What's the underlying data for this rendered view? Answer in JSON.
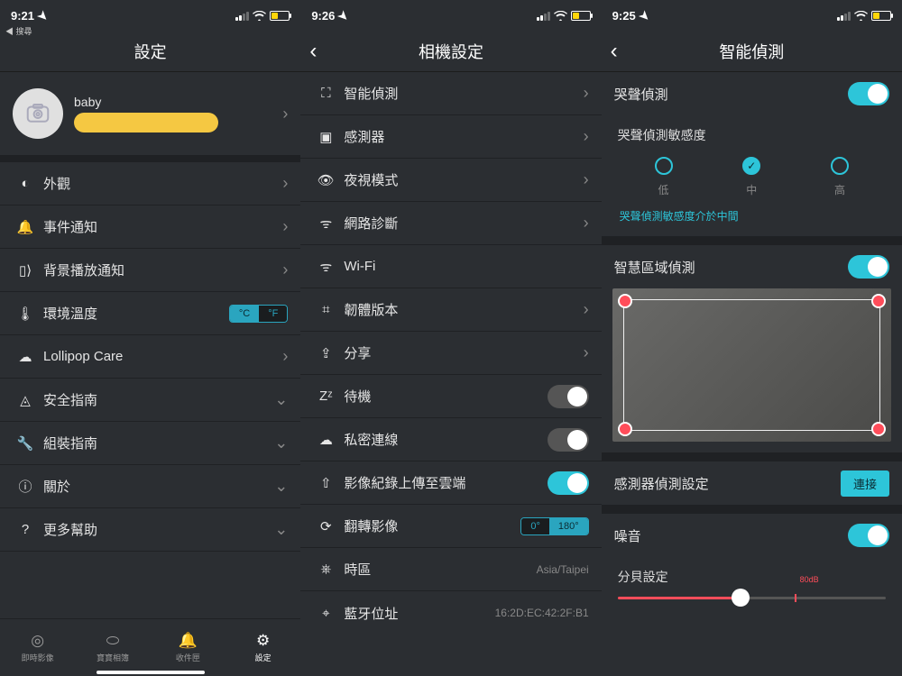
{
  "pane1": {
    "status": {
      "time": "9:21",
      "breadcrumb": "◀ 搜尋"
    },
    "title": "設定",
    "profile": {
      "name": "baby"
    },
    "items": [
      {
        "label": "外觀",
        "right": "chev"
      },
      {
        "label": "事件通知",
        "right": "chev"
      },
      {
        "label": "背景播放通知",
        "right": "chev"
      },
      {
        "label": "環境溫度",
        "right": "temp"
      },
      {
        "label": "Lollipop Care",
        "right": "chev"
      },
      {
        "label": "安全指南",
        "right": "down"
      },
      {
        "label": "組裝指南",
        "right": "down"
      },
      {
        "label": "關於",
        "right": "down"
      },
      {
        "label": "更多幫助",
        "right": "down"
      }
    ],
    "temp": {
      "on": "°C",
      "off": "°F"
    },
    "tabs": [
      {
        "label": "即時影像"
      },
      {
        "label": "寶寶相簿"
      },
      {
        "label": "收件匣"
      },
      {
        "label": "設定"
      }
    ]
  },
  "pane2": {
    "status": {
      "time": "9:26"
    },
    "title": "相機設定",
    "items": [
      {
        "label": "智能偵測",
        "right": "chev"
      },
      {
        "label": "感測器",
        "right": "chev"
      },
      {
        "label": "夜視模式",
        "right": "chev"
      },
      {
        "label": "網路診斷",
        "right": "chev"
      },
      {
        "label": "Wi-Fi",
        "right": "value",
        "value": ""
      },
      {
        "label": "韌體版本",
        "right": "chev"
      },
      {
        "label": "分享",
        "right": "chev"
      },
      {
        "label": "待機",
        "right": "toggle-off"
      },
      {
        "label": "私密連線",
        "right": "toggle-off"
      },
      {
        "label": "影像紀錄上傳至雲端",
        "right": "toggle-on"
      },
      {
        "label": "翻轉影像",
        "right": "rot"
      },
      {
        "label": "時區",
        "right": "value",
        "value": "Asia/Taipei"
      },
      {
        "label": "藍牙位址",
        "right": "value",
        "value": "16:2D:EC:42:2F:B1"
      }
    ],
    "rot": {
      "off": "0°",
      "on": "180°"
    }
  },
  "pane3": {
    "status": {
      "time": "9:25"
    },
    "title": "智能偵測",
    "cry": {
      "label": "哭聲偵測",
      "sensLabel": "哭聲偵測敏感度",
      "opts": [
        "低",
        "中",
        "高"
      ],
      "hint": "哭聲偵測敏感度介於中間"
    },
    "zone": {
      "label": "智慧區域偵測"
    },
    "sensor": {
      "label": "感測器偵測設定",
      "btn": "連接"
    },
    "noise": {
      "label": "噪音",
      "db": "分貝設定",
      "mark": "80dB"
    }
  }
}
